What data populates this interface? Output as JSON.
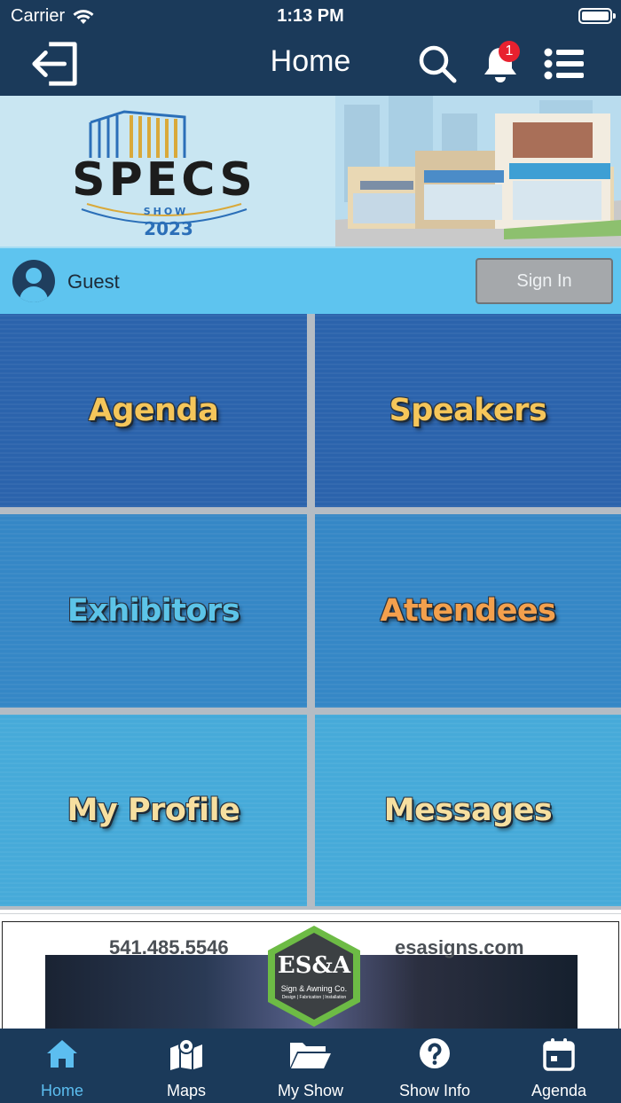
{
  "status_bar": {
    "carrier": "Carrier",
    "time": "1:13 PM"
  },
  "nav": {
    "title": "Home",
    "notification_count": "1",
    "icons": [
      "logout-icon",
      "search-icon",
      "bell-icon",
      "list-menu-icon"
    ]
  },
  "banner": {
    "logo_wordmark": "SPECS",
    "logo_line2": "SHOW",
    "logo_year": "2023"
  },
  "user": {
    "name": "Guest",
    "sign_in_label": "Sign In"
  },
  "tiles": [
    {
      "label": "Agenda",
      "color": "#f5c65a"
    },
    {
      "label": "Speakers",
      "color": "#f5c65a"
    },
    {
      "label": "Exhibitors",
      "color": "#5cc4e8"
    },
    {
      "label": "Attendees",
      "color": "#f3a04d"
    },
    {
      "label": "My Profile",
      "color": "#f6dfa0"
    },
    {
      "label": "Messages",
      "color": "#f6dfa0"
    }
  ],
  "ad": {
    "phone": "541.485.5546",
    "website": "esasigns.com",
    "brand": "ES&A",
    "brand_sub": "Sign & Awning Co.",
    "brand_tagline": "Design | Fabrication | Installation"
  },
  "tabbar": {
    "items": [
      {
        "label": "Home",
        "icon": "home-icon",
        "active": true
      },
      {
        "label": "Maps",
        "icon": "map-icon",
        "active": false
      },
      {
        "label": "My Show",
        "icon": "folder-icon",
        "active": false
      },
      {
        "label": "Show Info",
        "icon": "help-circle-icon",
        "active": false
      },
      {
        "label": "Agenda",
        "icon": "calendar-icon",
        "active": false
      }
    ]
  },
  "colors": {
    "navbar": "#1b3a5a",
    "guest_bar": "#5ec4ef",
    "active_tab": "#5cbef0",
    "badge": "#e8212f"
  }
}
